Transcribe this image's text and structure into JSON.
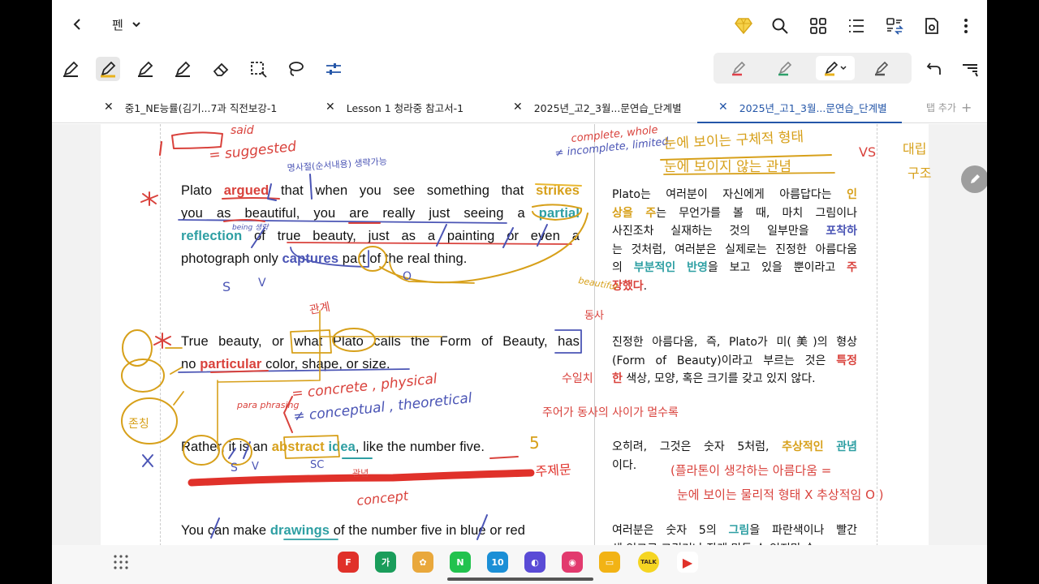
{
  "header": {
    "mode_label": "펜",
    "icons": [
      "back-chevron-icon",
      "diamond-icon",
      "search-icon",
      "grid-icon",
      "list-icon",
      "convert-icon",
      "save-icon",
      "more-vertical-icon"
    ]
  },
  "toolbar": {
    "tools": [
      "pen-icon",
      "highlighter-icon",
      "pen-icon",
      "pen-icon",
      "eraser-icon",
      "lasso-select-icon",
      "lasso-icon",
      "settings-sliders-icon"
    ],
    "active_tool": "highlighter",
    "pen_colors": [
      "#e0404a",
      "#2ea06a",
      "#e8b21c",
      "#555555"
    ]
  },
  "tabs": [
    {
      "label": "중1_NE능률(김기...7과 직전보강-1",
      "active": false
    },
    {
      "label": "Lesson 1 청라중 참고서-1",
      "active": false
    },
    {
      "label": "2025년_고2_3월...문연습_단계별",
      "active": false
    },
    {
      "label": "2025년_고1_3월...문연습_단계별",
      "active": true
    }
  ],
  "tab_add_label": "탭 추가",
  "document": {
    "english": {
      "p1": [
        [
          "Plato ",
          {
            "t": "argued",
            "c": "red"
          },
          " that when you see something that ",
          {
            "t": "strikes",
            "c": "gold"
          }
        ],
        [
          "you as beautiful, you are really just seeing a ",
          {
            "t": "partial",
            "c": "teal"
          }
        ],
        [
          {
            "t": "reflection",
            "c": "teal"
          },
          " of true beauty, just as a painting or even a"
        ],
        [
          "photograph only ",
          {
            "t": "captures",
            "c": "blue"
          },
          " part of the real thing."
        ]
      ],
      "p2": [
        [
          "True beauty, or what Plato calls the Form of Beauty, has"
        ],
        [
          "no ",
          {
            "t": "particular",
            "c": "red"
          },
          " color, shape, or size."
        ]
      ],
      "p3": [
        [
          "Rather, it is an ",
          {
            "t": "abstract",
            "c": "gold"
          },
          " ",
          {
            "t": "idea",
            "c": "teal"
          },
          ", like the number five."
        ]
      ],
      "p4": [
        [
          "You can make ",
          {
            "t": "drawings",
            "c": "teal"
          },
          " of the number five in blue or red"
        ]
      ]
    },
    "korean": {
      "k1": [
        [
          "Plato는 여러분이 자신에게 아름답다는 ",
          {
            "t": "인",
            "c": "gold"
          }
        ],
        [
          {
            "t": "상을 주",
            "c": "gold"
          },
          "는 무언가를 볼 때, 마치 그림이나"
        ],
        [
          "사진조차 실재하는 것의 일부만을 ",
          {
            "t": "포착하",
            "c": "blue"
          }
        ],
        [
          "는 것처럼, 여러분은 실제로는 진정한 아름다움"
        ],
        [
          "의 ",
          {
            "t": "부분적인",
            "c": "teal"
          },
          " ",
          {
            "t": "반영",
            "c": "teal"
          },
          "을 보고 있을 뿐이라고 ",
          {
            "t": "주",
            "c": "red"
          }
        ],
        [
          {
            "t": "장했다",
            "c": "red"
          },
          "."
        ]
      ],
      "k2": [
        [
          "진정한 아름다움, 즉, Plato가 미(美)의 형상"
        ],
        [
          "(Form of Beauty)이라고 부르는 것은 ",
          {
            "t": "특정",
            "c": "red"
          }
        ],
        [
          {
            "t": "한",
            "c": "red"
          },
          " 색상, 모양, 혹은 크기를 갖고 있지 않다."
        ]
      ],
      "k3": [
        [
          "오히려, 그것은 숫자 5처럼, ",
          {
            "t": "추상적인",
            "c": "gold"
          },
          " ",
          {
            "t": "관념",
            "c": "teal"
          }
        ],
        [
          "이다."
        ]
      ],
      "k4": [
        [
          "여러분은 숫자 5의 ",
          {
            "t": "그림",
            "c": "teal"
          },
          "을 파란색이나 빨간"
        ],
        [
          "색 잉크로 그리거나 작게 만들 수 있지만 숫"
        ]
      ]
    }
  },
  "annotations": {
    "said": "said",
    "suggested": "= suggested",
    "complete": "complete, whole",
    "incomplete": "≠ incomplete, limited",
    "kr_top1": "눈에 보이는 구체적 형태",
    "kr_top2": "눈에 보이지 않는 관념",
    "vs": "VS",
    "contrast": "대립",
    "structure": "구조",
    "content_func": "명사절(순서내용) 생략가능",
    "being": "being 생략",
    "beautiful_note": "beautiful",
    "emphasis": "관계",
    "concrete": "= concrete , physical",
    "conceptual": "≠ conceptual , theoretical",
    "paraphrasing": "para phrasing",
    "subject_long": "주어가 동사의 사이가 멀수록",
    "topic": "주제문",
    "singular": "수일치",
    "verb": "동사",
    "concept": "concept",
    "idea_kr": "관념",
    "kr_note": "(플라톤이 생각하는 아름다움 =",
    "kr_note2": "눈에 보이는 물리적 형태 X 추상적임 O )",
    "honorific": "존칭",
    "five": "5",
    "S": "S",
    "V": "V",
    "SC": "SC",
    "O": "O"
  },
  "dock": {
    "apps": [
      {
        "name": "flipboard-app",
        "color": "#e0312a",
        "glyph": "F"
      },
      {
        "name": "dictionary-app",
        "color": "#1a9d5b",
        "glyph": "가"
      },
      {
        "name": "gallery-app",
        "color": "#e9a83c",
        "glyph": "✿"
      },
      {
        "name": "naver-app",
        "color": "#22c24e",
        "glyph": "N"
      },
      {
        "name": "calendar-app",
        "color": "#1b8fd6",
        "glyph": "10"
      },
      {
        "name": "browser-app",
        "color": "#5a4bd6",
        "glyph": "◐"
      },
      {
        "name": "camera-app",
        "color": "#e23a6e",
        "glyph": "◉"
      },
      {
        "name": "files-app",
        "color": "#f2b315",
        "glyph": "▭"
      },
      {
        "name": "kakaotalk-app",
        "color": "#f5d522",
        "glyph": "TALK"
      },
      {
        "name": "youtube-app",
        "color": "#ffffff",
        "glyph": "▶"
      }
    ]
  }
}
